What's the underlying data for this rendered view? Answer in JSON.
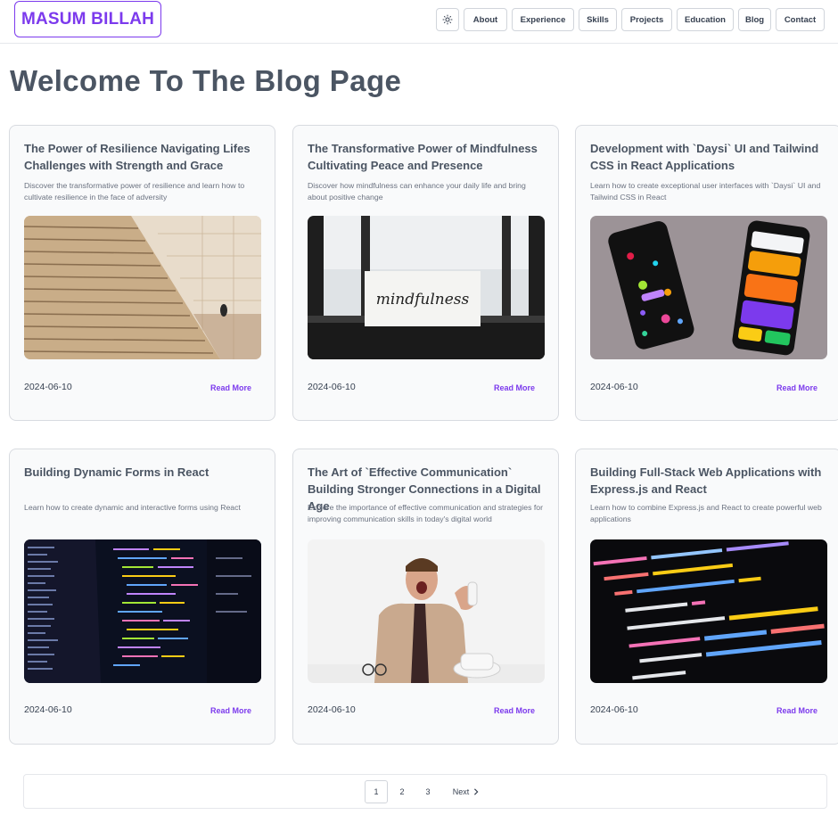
{
  "header": {
    "logo": "MASUM BILLAH",
    "theme_icon": "sun-icon",
    "nav": [
      "About",
      "Experience",
      "Skills",
      "Projects",
      "Education",
      "Blog",
      "Contact"
    ]
  },
  "page_title": "Welcome To The Blog Page",
  "colors": {
    "accent": "#7c3aed",
    "title": "#4b5563",
    "card_bg": "#f9fafb"
  },
  "posts": [
    {
      "title": "The Power of Resilience Navigating Lifes Challenges with Strength and Grace",
      "description": "Discover the transformative power of resilience and learn how to cultivate resilience in the face of adversity",
      "image": "stairs-photo",
      "date": "2024-06-10",
      "read_more": "Read More"
    },
    {
      "title": "The Transformative Power of Mindfulness Cultivating Peace and Presence",
      "description": "Discover how mindfulness can enhance your daily life and bring about positive change",
      "image": "mindfulness-sign-photo",
      "image_text": "mindfulness",
      "date": "2024-06-10",
      "read_more": "Read More"
    },
    {
      "title": "Development with `Daysi` UI and Tailwind CSS in React Applications",
      "description": "Learn how to create exceptional user interfaces with `Daysi` UI and Tailwind CSS in React",
      "image": "phones-ui-photo",
      "date": "2024-06-10",
      "read_more": "Read More"
    },
    {
      "title": "Building Dynamic Forms in React",
      "description": "Learn how to create dynamic and interactive forms using React",
      "image": "code-editor-photo",
      "date": "2024-06-10",
      "read_more": "Read More"
    },
    {
      "title": "The Art of `Effective Communication` Building Stronger Connections in a Digital Age",
      "description": "Explore the importance of effective communication and strategies for improving communication skills in today's digital world",
      "image": "man-shouting-phone-photo",
      "date": "2024-06-10",
      "read_more": "Read More"
    },
    {
      "title": "Building Full-Stack Web Applications with Express.js and React",
      "description": "Learn how to combine Express.js and React to create powerful web applications",
      "image": "code-closeup-photo",
      "date": "2024-06-10",
      "read_more": "Read More"
    }
  ],
  "pagination": {
    "pages": [
      "1",
      "2",
      "3"
    ],
    "current": "1",
    "next": "Next",
    "next_icon": "chevron-right-icon"
  }
}
